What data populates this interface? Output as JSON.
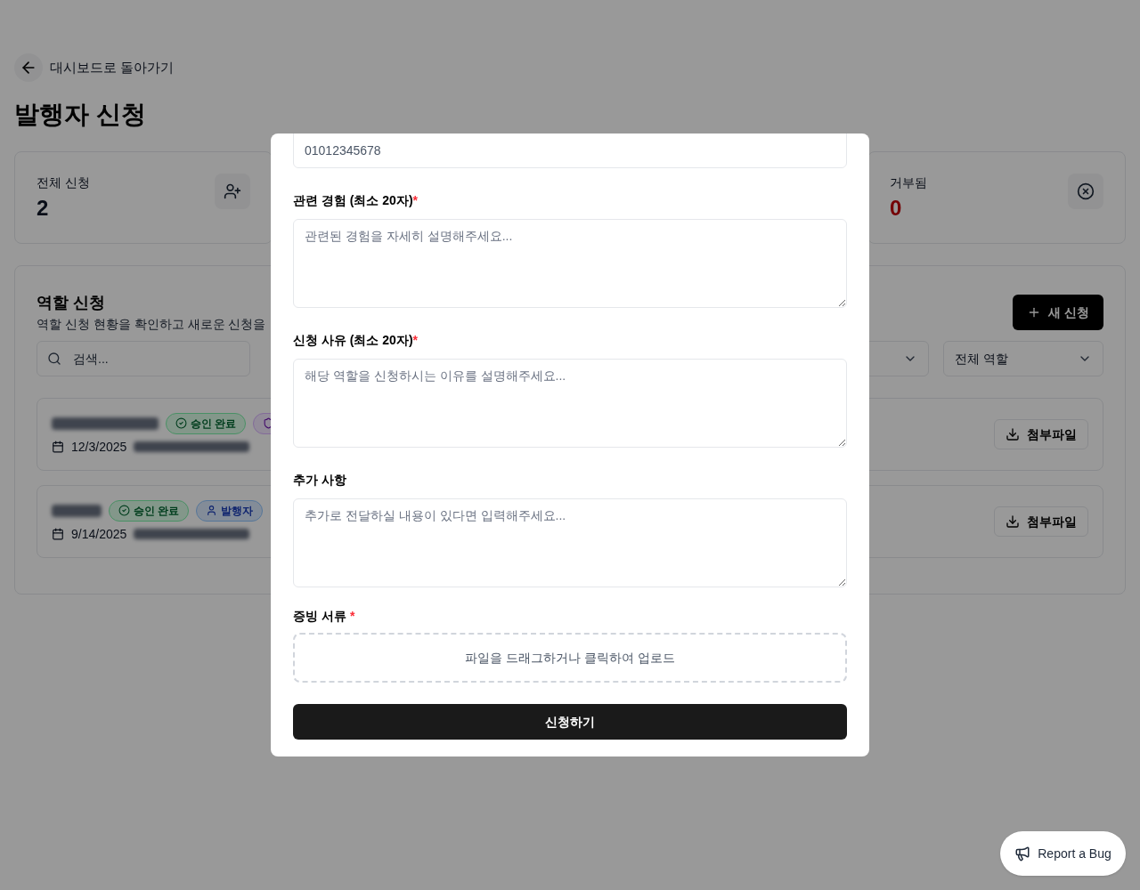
{
  "back_link": {
    "label": "대시보드로 돌아가기"
  },
  "page_title": "발행자 신청",
  "stats": [
    {
      "label": "전체 신청",
      "value": "2",
      "kind": "total"
    },
    {
      "label": "거부됨",
      "value": "0",
      "kind": "rejected"
    }
  ],
  "panel": {
    "title": "역할 신청",
    "subtitle": "역할 신청 현황을 확인하고 새로운 신청을",
    "new_button": "새 신청",
    "search": {
      "placeholder": "검색..."
    },
    "filters": [
      {
        "kind": "select"
      },
      {
        "kind": "select",
        "value": "전체 역할"
      }
    ],
    "items": [
      {
        "date": "12/3/2025",
        "badges": [
          {
            "label": "승인 완료",
            "kind": "status"
          },
          {
            "kind": "admin"
          }
        ],
        "attachment": "첨부파일"
      },
      {
        "date": "9/14/2025",
        "badges": [
          {
            "label": "승인 완료",
            "kind": "status"
          },
          {
            "label": "발행자",
            "kind": "role"
          }
        ],
        "attachment": "첨부파일"
      }
    ]
  },
  "modal": {
    "phone": {
      "value": "01012345678"
    },
    "fields": [
      {
        "label": "관련 경험 (최소 20자)",
        "required_mark": "*",
        "placeholder": "관련된 경험을 자세히 설명해주세요..."
      },
      {
        "label": "신청 사유 (최소 20자)",
        "required_mark": "*",
        "placeholder": "해당 역할을 신청하시는 이유를 설명해주세요..."
      },
      {
        "label": "추가 사항",
        "placeholder": "추가로 전달하실 내용이 있다면 입력해주세요..."
      }
    ],
    "upload": {
      "label": "증빙 서류",
      "required_mark": "*",
      "hint": "파일을 드래그하거나 클릭하여 업로드"
    },
    "submit": "신청하기"
  },
  "bug_button": "Report a Bug"
}
